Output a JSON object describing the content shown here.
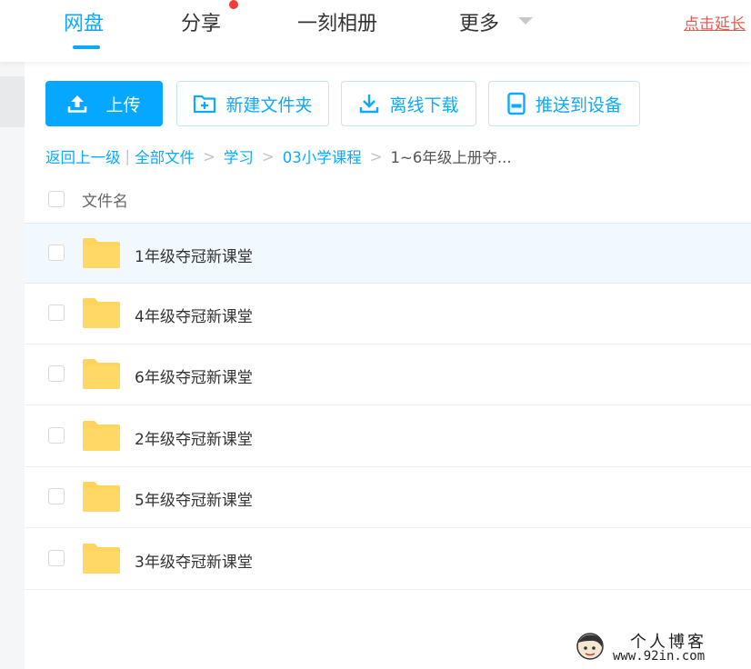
{
  "nav": {
    "items": [
      {
        "label": "网盘"
      },
      {
        "label": "分享"
      },
      {
        "label": "一刻相册"
      },
      {
        "label": "更多"
      }
    ],
    "promo": "点击延长"
  },
  "toolbar": {
    "upload": "上传",
    "new_folder": "新建文件夹",
    "offline_download": "离线下载",
    "push_device": "推送到设备"
  },
  "breadcrumb": {
    "back": "返回上一级",
    "items": [
      "全部文件",
      "学习",
      "03小学课程"
    ],
    "current": "1~6年级上册夺..."
  },
  "list": {
    "header": "文件名",
    "rows": [
      {
        "name": "1年级夺冠新课堂"
      },
      {
        "name": "4年级夺冠新课堂"
      },
      {
        "name": "6年级夺冠新课堂"
      },
      {
        "name": "2年级夺冠新课堂"
      },
      {
        "name": "5年级夺冠新课堂"
      },
      {
        "name": "3年级夺冠新课堂"
      }
    ]
  },
  "watermark": {
    "title": "个人博客",
    "url": "www.92in.com"
  },
  "colors": {
    "accent": "#09aaff",
    "folder": "#ffd55e",
    "badge": "#f33b3b"
  }
}
